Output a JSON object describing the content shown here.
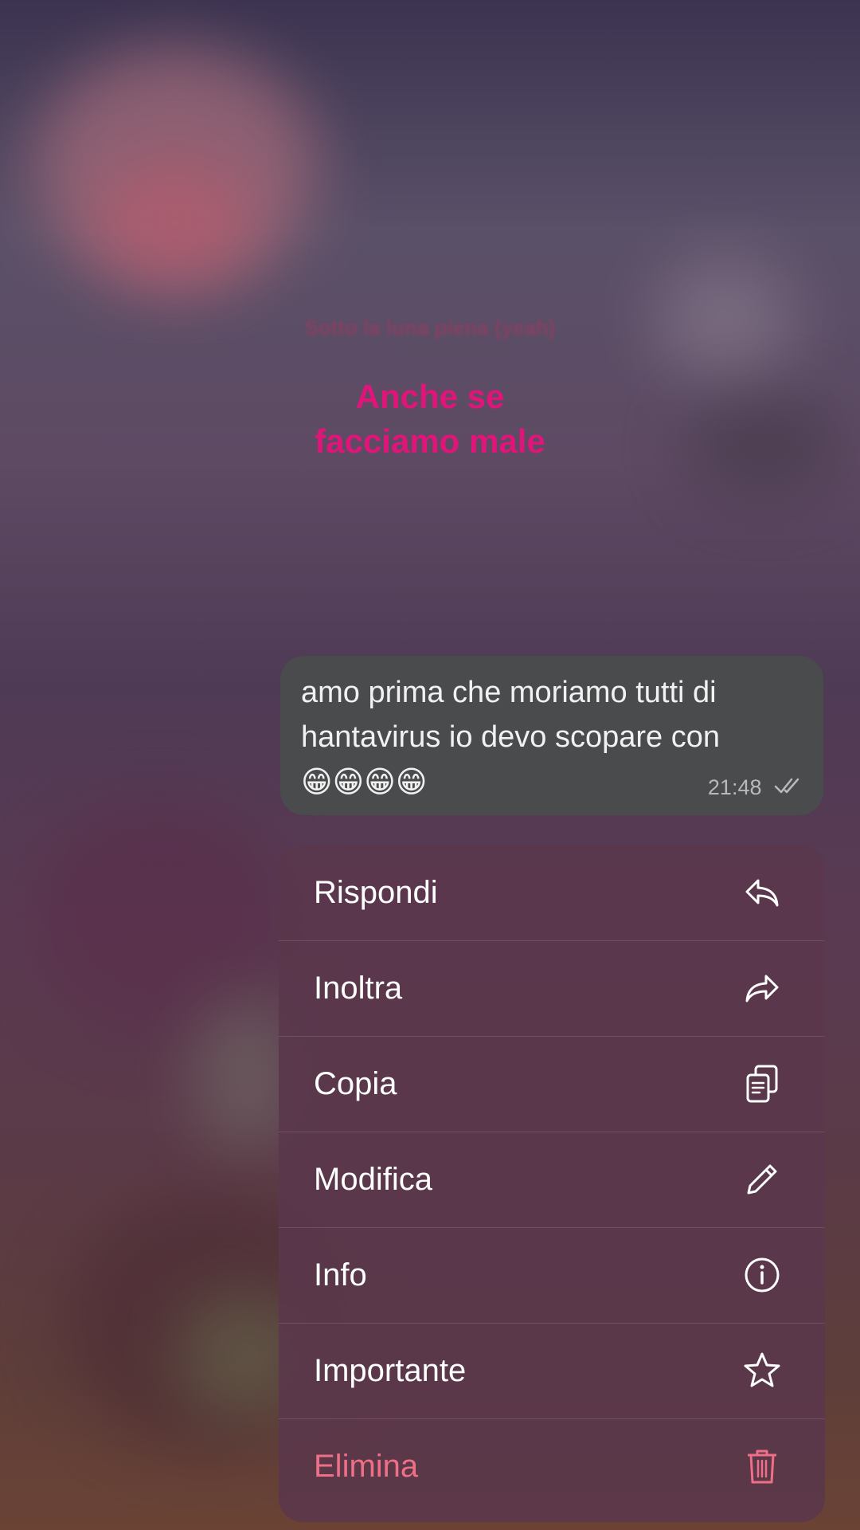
{
  "lyrics": {
    "small_line": "Sotto la luna piena (yeah)",
    "line1": "Anche se",
    "line2": "facciamo male"
  },
  "reactions": {
    "emojis": [
      "👍",
      "❤️",
      "😂",
      "😮",
      "😢",
      "🙏",
      "🤎"
    ],
    "more_label": "+"
  },
  "message": {
    "text": "amo prima che moriamo tutti di hantavirus io devo scopare con ",
    "emojis": "😁😁😁😁",
    "time": "21:48"
  },
  "menu": {
    "items": [
      {
        "label": "Rispondi",
        "icon": "reply-icon"
      },
      {
        "label": "Inoltra",
        "icon": "forward-icon"
      },
      {
        "label": "Copia",
        "icon": "copy-icon"
      },
      {
        "label": "Modifica",
        "icon": "pencil-icon"
      },
      {
        "label": "Info",
        "icon": "info-icon"
      },
      {
        "label": "Importante",
        "icon": "star-icon"
      },
      {
        "label": "Elimina",
        "icon": "trash-icon"
      }
    ]
  },
  "colors": {
    "danger": "#ef6f88",
    "reaction_bar": "#4a2845",
    "bubble": "#4a4b4d"
  }
}
